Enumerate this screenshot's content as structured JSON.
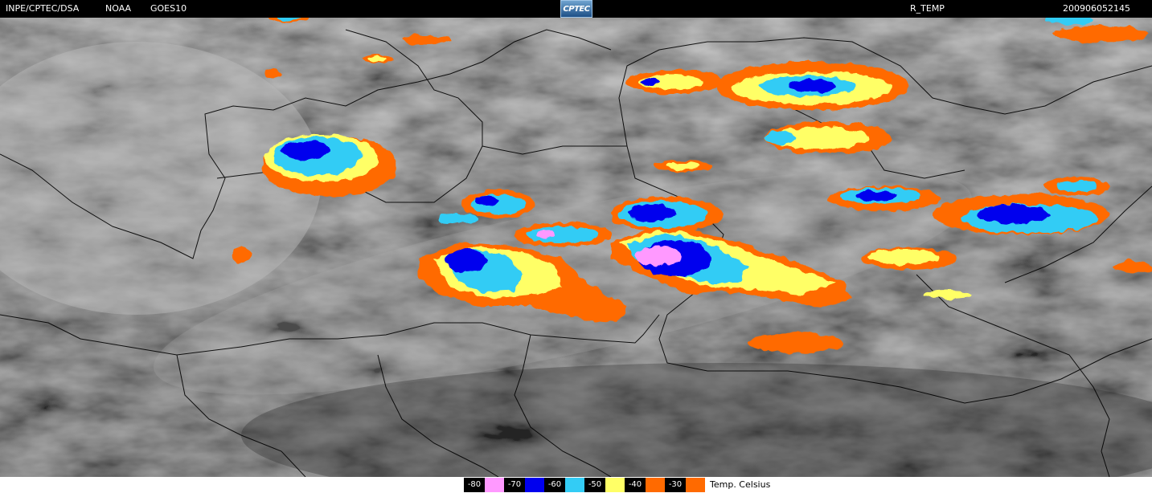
{
  "header": {
    "organization": "INPE/CPTEC/DSA",
    "agency": "NOAA",
    "satellite": "GOES10",
    "product": "R_TEMP",
    "timestamp": "200906052145",
    "logo_text": "CPTEC"
  },
  "legend": {
    "unit": "Temp. Celsius",
    "items": [
      {
        "label": "-80",
        "color": "#ff99ff"
      },
      {
        "label": "-70",
        "color": "#0000ee"
      },
      {
        "label": "-60",
        "color": "#33ccf5"
      },
      {
        "label": "-50",
        "color": "#ffff66"
      },
      {
        "label": "-40",
        "color": "#ff6a00"
      },
      {
        "label": "-30",
        "color": "#ff6a00"
      }
    ]
  },
  "colors": {
    "coldest": "#ff99ff",
    "very_cold": "#0000ee",
    "cold": "#33ccf5",
    "cool": "#ffff66",
    "warmish": "#ff6a00",
    "background_cloud": "#8a8a8a",
    "border_line": "#000000"
  }
}
